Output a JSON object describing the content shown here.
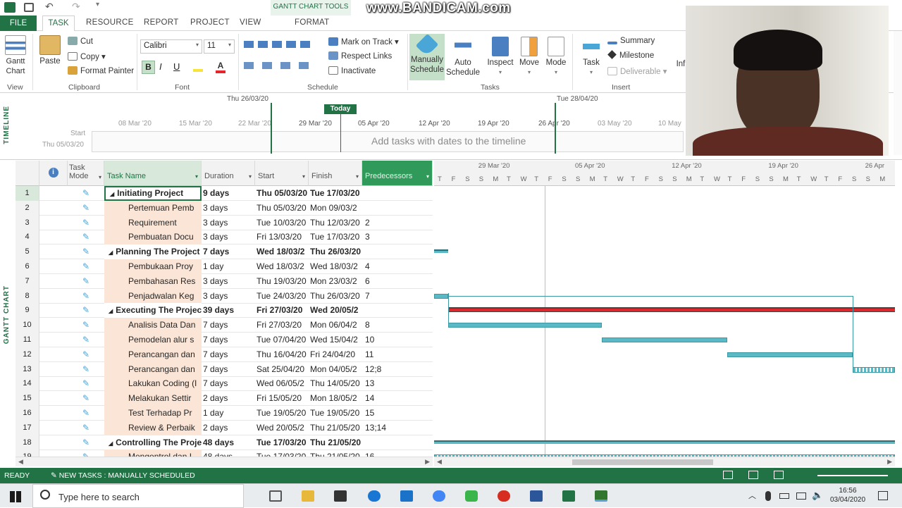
{
  "watermark": "www.BANDICAM.com",
  "context_tab_group": "GANTT CHART TOOLS",
  "tabs": [
    "FILE",
    "TASK",
    "RESOURCE",
    "REPORT",
    "PROJECT",
    "VIEW",
    "FORMAT"
  ],
  "ribbon": {
    "gantt_chart": "Gantt\nChart",
    "paste": "Paste",
    "cut": "Cut",
    "copy": "Copy",
    "format_painter": "Format Painter",
    "font_name": "Calibri",
    "font_size": "11",
    "bold": "B",
    "italic": "I",
    "underline": "U",
    "mark_on_track": "Mark on Track",
    "respect_links": "Respect Links",
    "inactivate": "Inactivate",
    "manually_schedule": "Manually\nSchedule",
    "auto_schedule": "Auto\nSchedule",
    "inspect": "Inspect",
    "move": "Move",
    "mode": "Mode",
    "task": "Task",
    "summary": "Summary",
    "milestone": "Milestone",
    "deliverable": "Deliverable",
    "info": "Inf",
    "groups": [
      "View",
      "Clipboard",
      "Font",
      "Schedule",
      "Tasks",
      "Insert"
    ]
  },
  "timeline": {
    "label": "TIMELINE",
    "start_date_top": "Thu 26/03/20",
    "end_date_top": "Tue 28/04/20",
    "today": "Today",
    "scale": [
      "08 Mar '20",
      "15 Mar '20",
      "22 Mar '20",
      "29 Mar '20",
      "05 Apr '20",
      "12 Apr '20",
      "19 Apr '20",
      "26 Apr '20",
      "03 May '20",
      "10 May"
    ],
    "start_label": "Start",
    "start_date": "Thu 05/03/20",
    "placeholder": "Add tasks with dates to the timeline"
  },
  "side_label": "GANTT CHART",
  "columns": {
    "mode": "Task\nMode",
    "name": "Task Name",
    "duration": "Duration",
    "start": "Start",
    "finish": "Finish",
    "pred": "Predecessors"
  },
  "gantt_header": {
    "weeks": [
      "29 Mar '20",
      "05 Apr '20",
      "12 Apr '20",
      "19 Apr '20",
      "26 Apr"
    ],
    "days": [
      "T",
      "F",
      "S",
      "S",
      "M",
      "T",
      "W",
      "T",
      "F",
      "S",
      "S",
      "M",
      "T",
      "W",
      "T",
      "F",
      "S",
      "S",
      "M",
      "T",
      "W",
      "T",
      "F",
      "S",
      "S",
      "M",
      "T",
      "W",
      "T",
      "F",
      "S",
      "S",
      "M"
    ]
  },
  "tasks": [
    {
      "id": "1",
      "name": "Initiating Project",
      "summary": true,
      "duration": "9 days",
      "start": "Thu 05/03/20",
      "finish": "Tue 17/03/20",
      "pred": ""
    },
    {
      "id": "2",
      "name": "Pertemuan Pemb",
      "summary": false,
      "duration": "3 days",
      "start": "Thu 05/03/20",
      "finish": "Mon 09/03/2",
      "pred": ""
    },
    {
      "id": "3",
      "name": "Requirement",
      "summary": false,
      "duration": "3 days",
      "start": "Tue 10/03/20",
      "finish": "Thu 12/03/20",
      "pred": "2"
    },
    {
      "id": "4",
      "name": "Pembuatan Docu",
      "summary": false,
      "duration": "3 days",
      "start": "Fri 13/03/20",
      "finish": "Tue 17/03/20",
      "pred": "3"
    },
    {
      "id": "5",
      "name": "Planning The Project",
      "summary": true,
      "duration": "7 days",
      "start": "Wed 18/03/2",
      "finish": "Thu 26/03/20",
      "pred": ""
    },
    {
      "id": "6",
      "name": "Pembukaan Proy",
      "summary": false,
      "duration": "1 day",
      "start": "Wed 18/03/2",
      "finish": "Wed 18/03/2",
      "pred": "4"
    },
    {
      "id": "7",
      "name": "Pembahasan Res",
      "summary": false,
      "duration": "3 days",
      "start": "Thu 19/03/20",
      "finish": "Mon 23/03/2",
      "pred": "6"
    },
    {
      "id": "8",
      "name": "Penjadwalan Keg",
      "summary": false,
      "duration": "3 days",
      "start": "Tue 24/03/20",
      "finish": "Thu 26/03/20",
      "pred": "7"
    },
    {
      "id": "9",
      "name": "Executing The Projec",
      "summary": true,
      "duration": "39 days",
      "start": "Fri 27/03/20",
      "finish": "Wed 20/05/2",
      "pred": ""
    },
    {
      "id": "10",
      "name": "Analisis Data Dan",
      "summary": false,
      "duration": "7 days",
      "start": "Fri 27/03/20",
      "finish": "Mon 06/04/2",
      "pred": "8"
    },
    {
      "id": "11",
      "name": "Pemodelan alur s",
      "summary": false,
      "duration": "7 days",
      "start": "Tue 07/04/20",
      "finish": "Wed 15/04/2",
      "pred": "10"
    },
    {
      "id": "12",
      "name": "Perancangan dan",
      "summary": false,
      "duration": "7 days",
      "start": "Thu 16/04/20",
      "finish": "Fri 24/04/20",
      "pred": "11"
    },
    {
      "id": "13",
      "name": "Perancangan dan",
      "summary": false,
      "duration": "7 days",
      "start": "Sat 25/04/20",
      "finish": "Mon 04/05/2",
      "pred": "12;8"
    },
    {
      "id": "14",
      "name": "Lakukan Coding (I",
      "summary": false,
      "duration": "7 days",
      "start": "Wed 06/05/2",
      "finish": "Thu 14/05/20",
      "pred": "13"
    },
    {
      "id": "15",
      "name": "Melakukan Settir",
      "summary": false,
      "duration": "2 days",
      "start": "Fri 15/05/20",
      "finish": "Mon 18/05/2",
      "pred": "14"
    },
    {
      "id": "16",
      "name": "Test Terhadap Pr",
      "summary": false,
      "duration": "1 day",
      "start": "Tue 19/05/20",
      "finish": "Tue 19/05/20",
      "pred": "15"
    },
    {
      "id": "17",
      "name": "Review & Perbaik",
      "summary": false,
      "duration": "2 days",
      "start": "Wed 20/05/2",
      "finish": "Thu 21/05/20",
      "pred": "13;14"
    },
    {
      "id": "18",
      "name": "Controlling The Proje",
      "summary": true,
      "duration": "48 days",
      "start": "Tue 17/03/20",
      "finish": "Thu 21/05/20",
      "pred": ""
    },
    {
      "id": "19",
      "name": "Mengontrol dan I",
      "summary": false,
      "duration": "48 days",
      "start": "Tue 17/03/20",
      "finish": "Thu 21/05/20",
      "pred": "16"
    }
  ],
  "status": {
    "ready": "READY",
    "new_tasks": "NEW TASKS : MANUALLY SCHEDULED"
  },
  "taskbar": {
    "search_placeholder": "Type here to search",
    "time": "16:56",
    "date": "03/04/2020"
  },
  "colors": {
    "accent": "#217346",
    "summary_bar": "#e3262c",
    "task_bar": "#5ab9c4",
    "name_highlight": "#fbe5d6"
  }
}
